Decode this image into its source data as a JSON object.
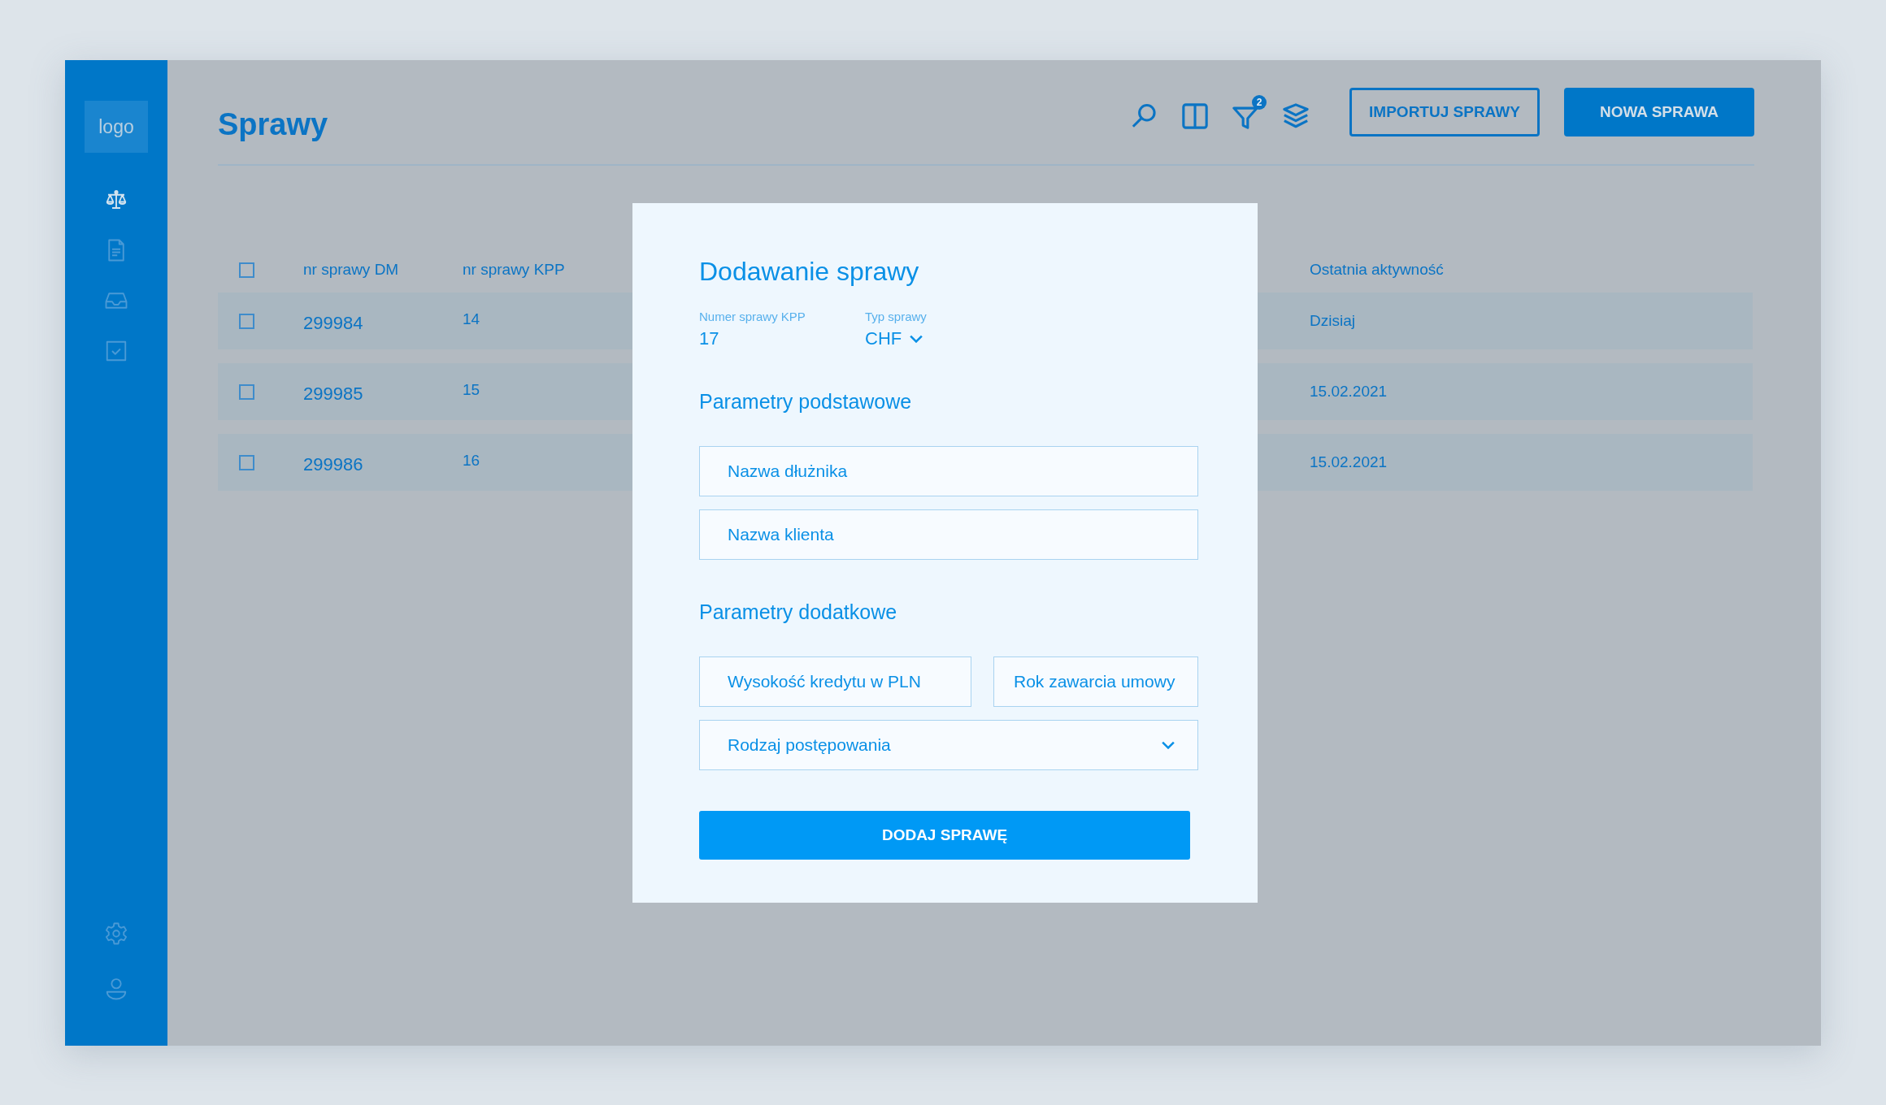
{
  "sidebar": {
    "logo": "logo",
    "items": [
      {
        "selected": true
      },
      {
        "selected": false
      },
      {
        "selected": false
      },
      {
        "selected": false
      }
    ]
  },
  "header": {
    "title": "Sprawy",
    "filter_badge": "2",
    "buttons": [
      {
        "label": "IMPORTUJ SPRAWY",
        "kind": "outline"
      },
      {
        "label": "NOWA SPRAWA",
        "kind": "primary"
      }
    ]
  },
  "table": {
    "select_all": {
      "checked": false
    },
    "columns": [
      "nr sprawy DM",
      "nr sprawy KPP",
      "Ostatnia aktywność"
    ],
    "rows": [
      {
        "checked": false,
        "cells": [
          "299984",
          "14",
          "Dzisiaj"
        ]
      },
      {
        "checked": false,
        "cells": [
          "299985",
          "15",
          "15.02.2021"
        ]
      },
      {
        "checked": false,
        "cells": [
          "299986",
          "16",
          "15.02.2021"
        ]
      }
    ]
  },
  "modal": {
    "title": "Dodawanie sprawy",
    "info": [
      {
        "label": "Numer sprawy KPP",
        "value": "17",
        "kind": "text"
      },
      {
        "label": "Typ sprawy",
        "value": "CHF",
        "kind": "dropdown"
      }
    ],
    "sections": [
      {
        "title": "Parametry podstawowe",
        "rows": [
          [
            {
              "placeholder": "Nazwa dłużnika",
              "kind": "input"
            }
          ],
          [
            {
              "placeholder": "Nazwa klienta",
              "kind": "input"
            }
          ]
        ]
      },
      {
        "title": "Parametry dodatkowe",
        "rows": [
          [
            {
              "placeholder": "Wysokość kredytu w PLN",
              "kind": "input"
            },
            {
              "placeholder": "Rok zawarcia umowy",
              "kind": "input"
            }
          ],
          [
            {
              "placeholder": "Rodzaj postępowania",
              "kind": "select"
            }
          ]
        ]
      }
    ],
    "submit": "DODAJ SPRAWĘ"
  }
}
